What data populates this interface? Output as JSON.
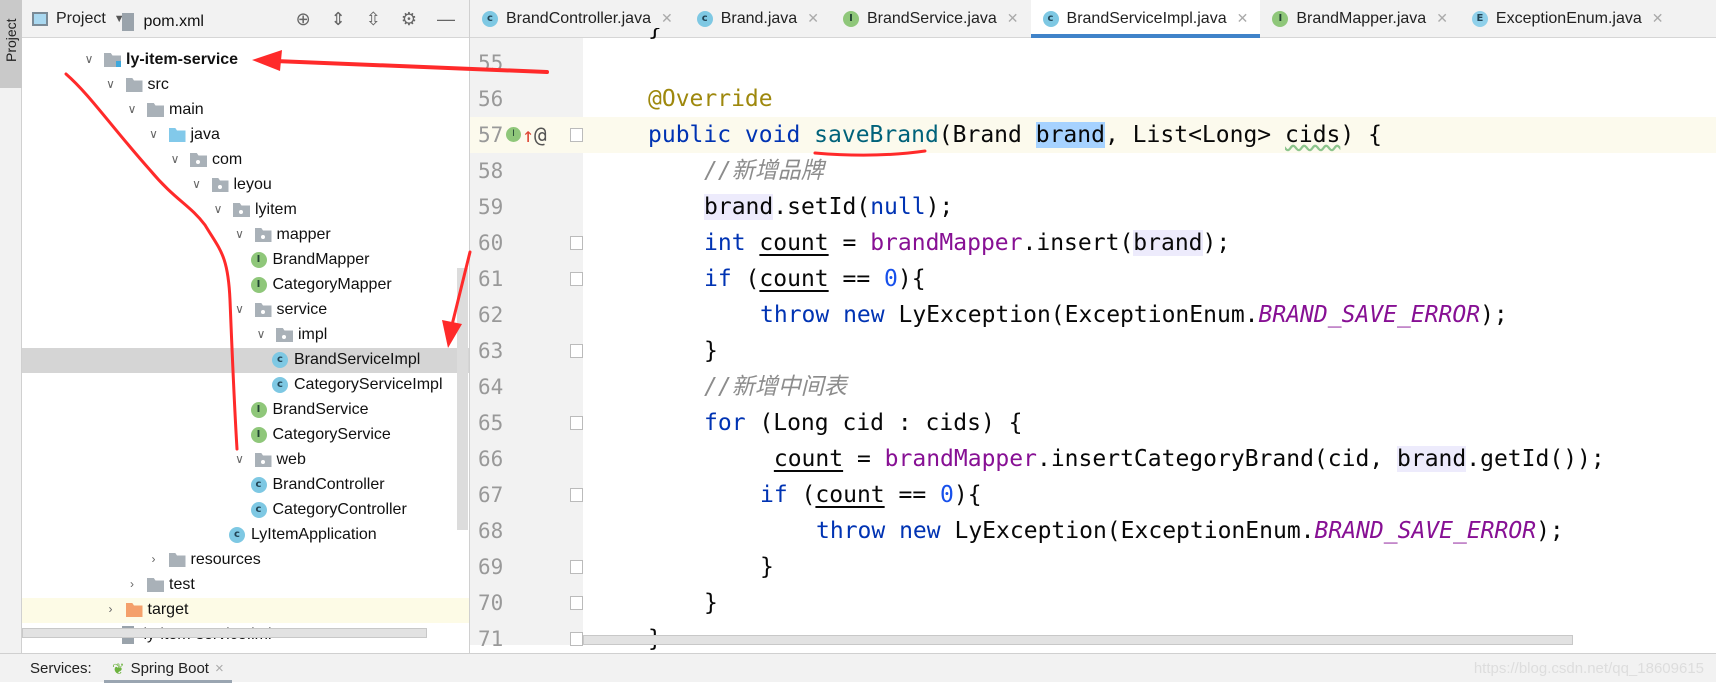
{
  "sidebar_strip": {
    "project_tab": "Project"
  },
  "project_panel": {
    "title": "Project",
    "tools": [
      "locate-icon",
      "expand-all-icon",
      "collapse-all-icon",
      "gear-icon",
      "minimize-icon"
    ],
    "tree": [
      {
        "label": "pom.xml",
        "level": 1,
        "icon": "file",
        "chevron": "none"
      },
      {
        "label": "ly-item-service",
        "level": 0,
        "icon": "module",
        "chevron": "open",
        "bold": true
      },
      {
        "label": "src",
        "level": 1,
        "icon": "folder",
        "chevron": "open"
      },
      {
        "label": "main",
        "level": 2,
        "icon": "folder",
        "chevron": "open"
      },
      {
        "label": "java",
        "level": 3,
        "icon": "blue",
        "chevron": "open"
      },
      {
        "label": "com",
        "level": 4,
        "icon": "pkg",
        "chevron": "open"
      },
      {
        "label": "leyou",
        "level": 5,
        "icon": "pkg",
        "chevron": "open"
      },
      {
        "label": "lyitem",
        "level": 6,
        "icon": "pkg",
        "chevron": "open"
      },
      {
        "label": "mapper",
        "level": 7,
        "icon": "pkg",
        "chevron": "open"
      },
      {
        "label": "BrandMapper",
        "level": 7,
        "icon": "ifc",
        "chevron": "none"
      },
      {
        "label": "CategoryMapper",
        "level": 7,
        "icon": "ifc",
        "chevron": "none"
      },
      {
        "label": "service",
        "level": 7,
        "icon": "pkg",
        "chevron": "open"
      },
      {
        "label": "impl",
        "level": 8,
        "icon": "pkg",
        "chevron": "open"
      },
      {
        "label": "BrandServiceImpl",
        "level": 8,
        "icon": "cls",
        "chevron": "none",
        "selected": true
      },
      {
        "label": "CategoryServiceImpl",
        "level": 8,
        "icon": "cls",
        "chevron": "none"
      },
      {
        "label": "BrandService",
        "level": 7,
        "icon": "ifc",
        "chevron": "none"
      },
      {
        "label": "CategoryService",
        "level": 7,
        "icon": "ifc",
        "chevron": "none"
      },
      {
        "label": "web",
        "level": 7,
        "icon": "pkg",
        "chevron": "open"
      },
      {
        "label": "BrandController",
        "level": 7,
        "icon": "cls",
        "chevron": "none"
      },
      {
        "label": "CategoryController",
        "level": 7,
        "icon": "cls",
        "chevron": "none"
      },
      {
        "label": "LyItemApplication",
        "level": 6,
        "icon": "cls",
        "chevron": "none"
      },
      {
        "label": "resources",
        "level": 3,
        "icon": "folder",
        "chevron": "closed"
      },
      {
        "label": "test",
        "level": 2,
        "icon": "folder",
        "chevron": "closed"
      },
      {
        "label": "target",
        "level": 1,
        "icon": "orange",
        "chevron": "closed",
        "highlight": true
      },
      {
        "label": "ly-item-service.iml",
        "level": 1,
        "icon": "file",
        "chevron": "none"
      }
    ]
  },
  "tabs": [
    {
      "label": "BrandController.java",
      "icon": "cls",
      "letter": "c"
    },
    {
      "label": "Brand.java",
      "icon": "cls",
      "letter": "c"
    },
    {
      "label": "BrandService.java",
      "icon": "ifc",
      "letter": "I"
    },
    {
      "label": "BrandServiceImpl.java",
      "icon": "cls",
      "letter": "c",
      "active": true
    },
    {
      "label": "BrandMapper.java",
      "icon": "ifc",
      "letter": "I"
    },
    {
      "label": "ExceptionEnum.java",
      "icon": "enm",
      "letter": "E"
    }
  ],
  "editor": {
    "top_partial": "}",
    "lines": [
      {
        "n": "55",
        "indent": 0,
        "tokens": []
      },
      {
        "n": "56",
        "indent": 0,
        "tokens": [
          [
            "@Override",
            "an"
          ]
        ]
      },
      {
        "n": "57",
        "indent": 0,
        "current": true,
        "gutter_icons": [
          "implements-icon",
          "override-arrow-icon",
          "annotation-icon"
        ],
        "tokens": [
          [
            "public void ",
            "kw"
          ],
          [
            "saveBrand",
            "fn"
          ],
          [
            "(Brand ",
            ""
          ],
          [
            "brand",
            "selw"
          ],
          [
            ", List<Long> ",
            ""
          ],
          [
            "cids",
            "warn"
          ],
          [
            ") {",
            ""
          ]
        ]
      },
      {
        "n": "58",
        "indent": 1,
        "tokens": [
          [
            "//新增品牌",
            "cm"
          ]
        ]
      },
      {
        "n": "59",
        "indent": 1,
        "tokens": [
          [
            "brand",
            "ref"
          ],
          [
            ".setId(",
            ""
          ],
          [
            "null",
            "kw"
          ],
          [
            ");",
            ""
          ]
        ]
      },
      {
        "n": "60",
        "indent": 1,
        "fold": true,
        "tokens": [
          [
            "int ",
            "kw"
          ],
          [
            "count",
            "var"
          ],
          [
            " = ",
            ""
          ],
          [
            "brandMapper",
            "mem"
          ],
          [
            ".insert(",
            ""
          ],
          [
            "brand",
            "ref"
          ],
          [
            ");",
            ""
          ]
        ]
      },
      {
        "n": "61",
        "indent": 1,
        "fold": true,
        "tokens": [
          [
            "if ",
            "kw"
          ],
          [
            "(",
            ""
          ],
          [
            "count",
            "var"
          ],
          [
            " == ",
            ""
          ],
          [
            "0",
            "nm"
          ],
          [
            "){",
            ""
          ]
        ]
      },
      {
        "n": "62",
        "indent": 2,
        "tokens": [
          [
            "throw new ",
            "kw"
          ],
          [
            "LyException(ExceptionEnum.",
            ""
          ],
          [
            "BRAND_SAVE_ERROR",
            "fd"
          ],
          [
            ");",
            ""
          ]
        ]
      },
      {
        "n": "63",
        "indent": 1,
        "fold": true,
        "tokens": [
          [
            "}",
            ""
          ]
        ]
      },
      {
        "n": "64",
        "indent": 1,
        "tokens": [
          [
            "//新增中间表",
            "cm"
          ]
        ]
      },
      {
        "n": "65",
        "indent": 1,
        "fold": true,
        "tokens": [
          [
            "for ",
            "kw"
          ],
          [
            "(Long cid : cids) {",
            ""
          ]
        ]
      },
      {
        "n": "66",
        "indent": 2,
        "tokens": [
          [
            " ",
            ""
          ],
          [
            "count",
            "var"
          ],
          [
            " = ",
            ""
          ],
          [
            "brandMapper",
            "mem"
          ],
          [
            ".insertCategoryBrand(cid, ",
            ""
          ],
          [
            "brand",
            "ref"
          ],
          [
            ".getId());",
            ""
          ]
        ]
      },
      {
        "n": "67",
        "indent": 2,
        "fold": true,
        "tokens": [
          [
            "if ",
            "kw"
          ],
          [
            "(",
            ""
          ],
          [
            "count",
            "var"
          ],
          [
            " == ",
            ""
          ],
          [
            "0",
            "nm"
          ],
          [
            "){",
            ""
          ]
        ]
      },
      {
        "n": "68",
        "indent": 3,
        "tokens": [
          [
            "throw new ",
            "kw"
          ],
          [
            "LyException(ExceptionEnum.",
            ""
          ],
          [
            "BRAND_SAVE_ERROR",
            "fd"
          ],
          [
            ");",
            ""
          ]
        ]
      },
      {
        "n": "69",
        "indent": 2,
        "fold": true,
        "tokens": [
          [
            "}",
            ""
          ]
        ]
      },
      {
        "n": "70",
        "indent": 1,
        "fold": true,
        "tokens": [
          [
            "}",
            ""
          ]
        ]
      },
      {
        "n": "71",
        "indent": 0,
        "fold": true,
        "tokens": [
          [
            "}",
            ""
          ]
        ]
      }
    ]
  },
  "bottom_bar": {
    "services_label": "Services:",
    "spring_boot_tab": "Spring Boot",
    "close": "×"
  },
  "watermark": "https://blog.csdn.net/qq_18609615",
  "colors": {
    "annotation_red": "#ff2a2a",
    "keyword": "#0033b3",
    "method": "#00627a",
    "selection": "#a6d2ff",
    "active_tab": "#4083c9"
  }
}
